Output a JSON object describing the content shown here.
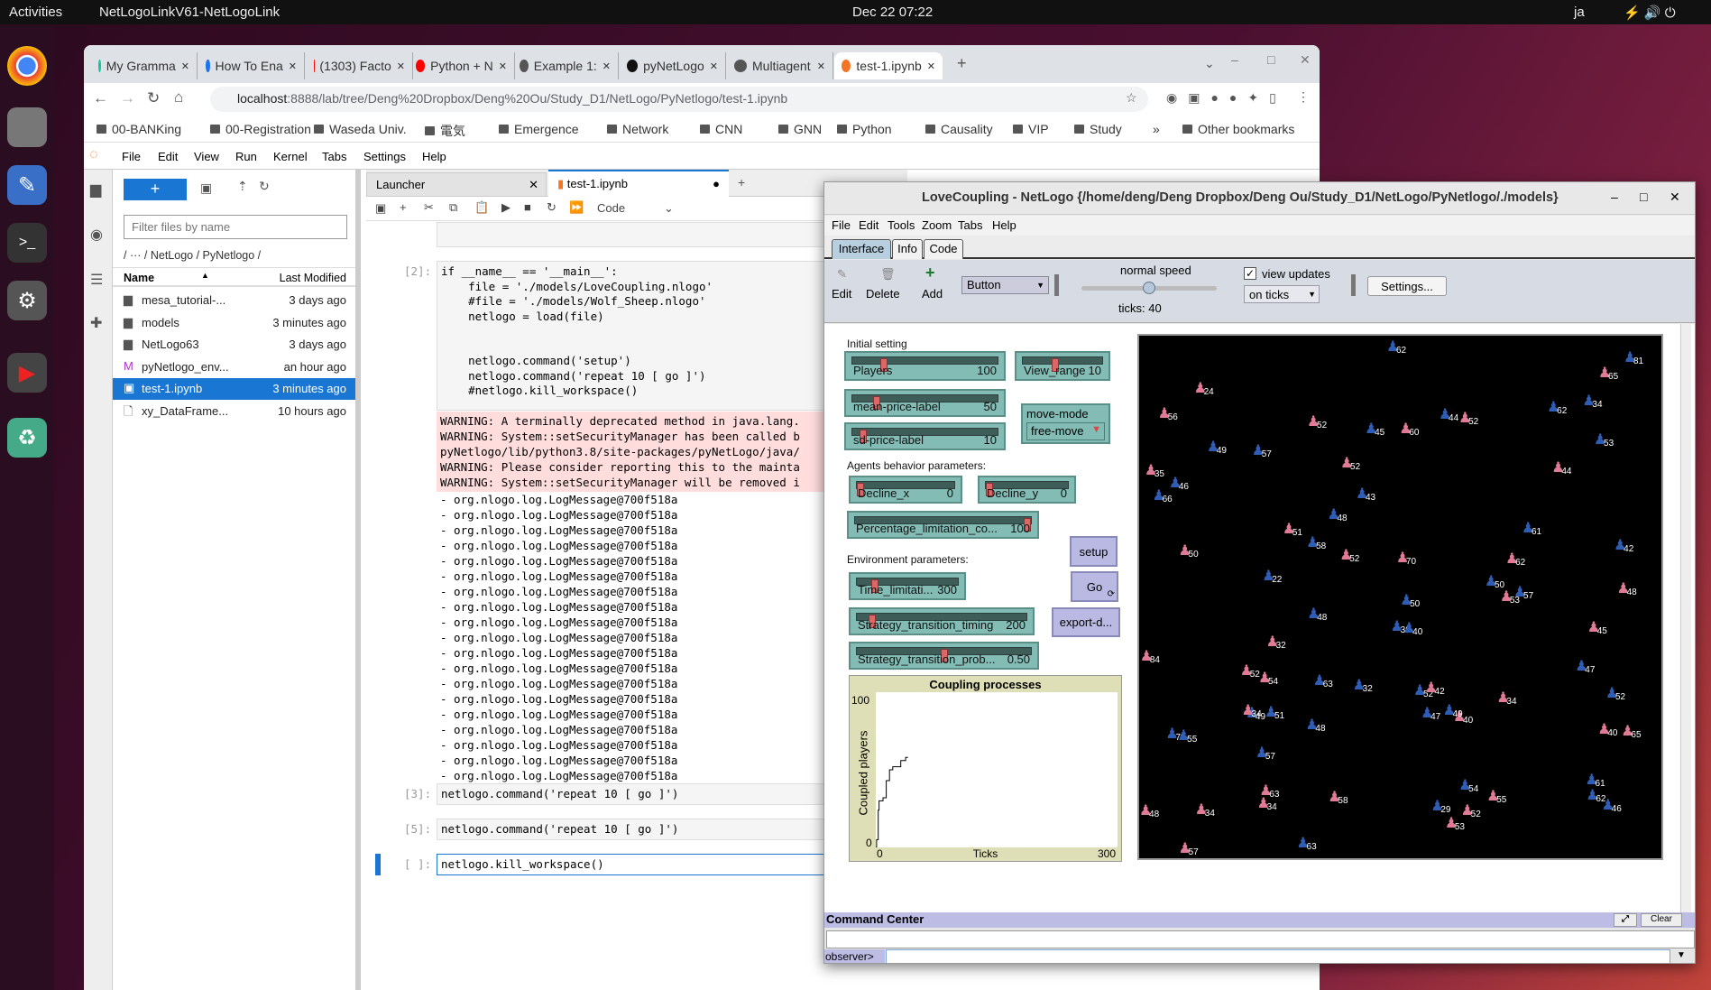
{
  "topbar": {
    "activities": "Activities",
    "app": "NetLogoLinkV61-NetLogoLink",
    "datetime": "Dec 22  07:22",
    "lang": "ja"
  },
  "chrome": {
    "tabs": [
      {
        "label": "My Gramma",
        "color": "#15c39a"
      },
      {
        "label": "How To Ena",
        "color": "#1a73e8"
      },
      {
        "label": "(1303) Facto",
        "color": "#f00"
      },
      {
        "label": "Python + N",
        "color": "#f00"
      },
      {
        "label": "Example 1:",
        "color": "#555"
      },
      {
        "label": "pyNetLogo",
        "color": "#111"
      },
      {
        "label": "Multiagent",
        "color": "#555"
      },
      {
        "label": "test-1.ipynb",
        "color": "#f37626"
      }
    ],
    "url_host": "localhost",
    "url_rest": ":8888/lab/tree/Deng%20Dropbox/Deng%20Ou/Study_D1/NetLogo/PyNetlogo/test-1.ipynb",
    "bookmarks": [
      "00-BANKing",
      "00-Registration",
      "Waseda Univ.",
      "電気",
      "Emergence",
      "Network",
      "CNN",
      "GNN",
      "Python",
      "Causality",
      "VIP",
      "Study"
    ],
    "more": "»",
    "other": "Other bookmarks"
  },
  "jupyter": {
    "menu": [
      "File",
      "Edit",
      "View",
      "Run",
      "Kernel",
      "Tabs",
      "Settings",
      "Help"
    ],
    "filter_placeholder": "Filter files by name",
    "breadcrumb": "/  ···  / NetLogo / PyNetlogo /",
    "col_name": "Name",
    "col_modified": "Last Modified",
    "files": [
      {
        "name": "mesa_tutorial-...",
        "modified": "3 days ago",
        "type": "folder"
      },
      {
        "name": "models",
        "modified": "3 minutes ago",
        "type": "folder"
      },
      {
        "name": "NetLogo63",
        "modified": "3 days ago",
        "type": "folder"
      },
      {
        "name": "pyNetlogo_env...",
        "modified": "an hour ago",
        "type": "markdown"
      },
      {
        "name": "test-1.ipynb",
        "modified": "3 minutes ago",
        "type": "notebook",
        "selected": true
      },
      {
        "name": "xy_DataFrame...",
        "modified": "10 hours ago",
        "type": "file"
      }
    ],
    "doc_tabs": [
      {
        "label": "Launcher"
      },
      {
        "label": "test-1.ipynb"
      }
    ],
    "cell_type": "Code",
    "cell2_prompt": "[2]:",
    "cell2_code": [
      "if __name__ == '__main__':",
      "    file = './models/LoveCoupling.nlogo'",
      "    #file = './models/Wolf_Sheep.nlogo'",
      "    netlogo = load(file)",
      "",
      "",
      "    netlogo.command('setup')",
      "    netlogo.command('repeat 10 [ go ]')",
      "    #netlogo.kill_workspace()"
    ],
    "warnings": [
      "WARNING: A terminally deprecated method in java.lang.",
      "WARNING: System::setSecurityManager has been called b",
      "pyNetlogo/lib/python3.8/site-packages/pyNetLogo/java/",
      "WARNING: Please consider reporting this to the mainta",
      "WARNING: System::setSecurityManager will be removed i"
    ],
    "log_line": "- org.nlogo.log.LogMessage@700f518a",
    "log_count": 19,
    "cells": [
      {
        "prompt": "[3]:",
        "code": "netlogo.command('repeat 10 [ go ]')"
      },
      {
        "prompt": "[5]:",
        "code": "netlogo.command('repeat 10 [ go ]')"
      },
      {
        "prompt": "[ ]:",
        "code": "netlogo.kill_workspace()"
      }
    ]
  },
  "netlogo": {
    "title": "LoveCoupling - NetLogo {/home/deng/Deng Dropbox/Deng Ou/Study_D1/NetLogo/PyNetlogo/./models}",
    "menu": [
      "File",
      "Edit",
      "Tools",
      "Zoom",
      "Tabs",
      "Help"
    ],
    "tabs": [
      "Interface",
      "Info",
      "Code"
    ],
    "toolbar": {
      "edit": "Edit",
      "delete": "Delete",
      "add": "Add",
      "widget": "Button",
      "speed": "normal speed",
      "speed_value": 0.5,
      "ticks": "ticks: 40",
      "view_updates": "view updates",
      "view_updates_checked": true,
      "update_mode": "on ticks",
      "settings": "Settings..."
    },
    "labels": {
      "initial": "Initial setting",
      "agents": "Agents behavior parameters:",
      "env": "Environment parameters:"
    },
    "sliders": [
      {
        "label": "Players",
        "value": "100",
        "fraction": 0.2
      },
      {
        "label": "View_range",
        "value": "10",
        "fraction": 0.4
      },
      {
        "label": "mean-price-label",
        "value": "50",
        "fraction": 0.15
      },
      {
        "label": "sd-price-label",
        "value": "10",
        "fraction": 0.05
      },
      {
        "label": "Decline_x",
        "value": "0",
        "fraction": 0
      },
      {
        "label": "Decline_y",
        "value": "0",
        "fraction": 0
      },
      {
        "label": "Percentage_limitation_co...",
        "value": "100",
        "fraction": 1
      },
      {
        "label": "Time_limitati...",
        "value": "300",
        "fraction": 0.15
      },
      {
        "label": "Strategy_transition_timing",
        "value": "200",
        "fraction": 0.07
      },
      {
        "label": "Strategy_transition_prob...",
        "value": "0.50",
        "fraction": 0.5
      }
    ],
    "chooser": {
      "label": "move-mode",
      "value": "free-move"
    },
    "buttons": {
      "setup": "setup",
      "go": "Go",
      "export": "export-d..."
    },
    "agents": {
      "colors": {
        "female": "#e07a95",
        "male": "#2f5db5"
      },
      "labels": [
        "48",
        "49",
        "48",
        "52",
        "44",
        "34",
        "50",
        "62",
        "52",
        "29",
        "48",
        "52",
        "43",
        "47",
        "46",
        "70",
        "65",
        "63",
        "60",
        "51",
        "48",
        "34",
        "47",
        "50",
        "42",
        "32",
        "58",
        "34",
        "50",
        "57",
        "52",
        "44",
        "62",
        "40",
        "35",
        "84",
        "57",
        "63",
        "58",
        "62",
        "52",
        "53",
        "42",
        "57",
        "70",
        "53",
        "34",
        "55",
        "61",
        "65",
        "51",
        "52",
        "45",
        "40",
        "62",
        "63",
        "54",
        "52",
        "36",
        "48",
        "45",
        "40",
        "61",
        "66",
        "34",
        "54",
        "55",
        "46",
        "81",
        "49",
        "56",
        "24",
        "53",
        "49",
        "22",
        "32",
        "52",
        "57"
      ]
    }
  },
  "chart_data": {
    "type": "line",
    "title": "Coupling processes",
    "xlabel": "Ticks",
    "ylabel": "Coupled players",
    "xlim": [
      0,
      300
    ],
    "ylim": [
      0,
      100
    ],
    "xticks": [
      "0",
      "300"
    ],
    "yticks": [
      "0",
      "100"
    ],
    "x": [
      0,
      1,
      3,
      4,
      9,
      13,
      17,
      21,
      28,
      31,
      36,
      37,
      40
    ],
    "y": [
      0,
      5,
      24,
      30,
      32,
      43,
      50,
      52,
      52,
      56,
      56,
      58,
      58
    ]
  },
  "command_center": {
    "title": "Command Center",
    "clear": "Clear",
    "prompt": "observer>"
  }
}
